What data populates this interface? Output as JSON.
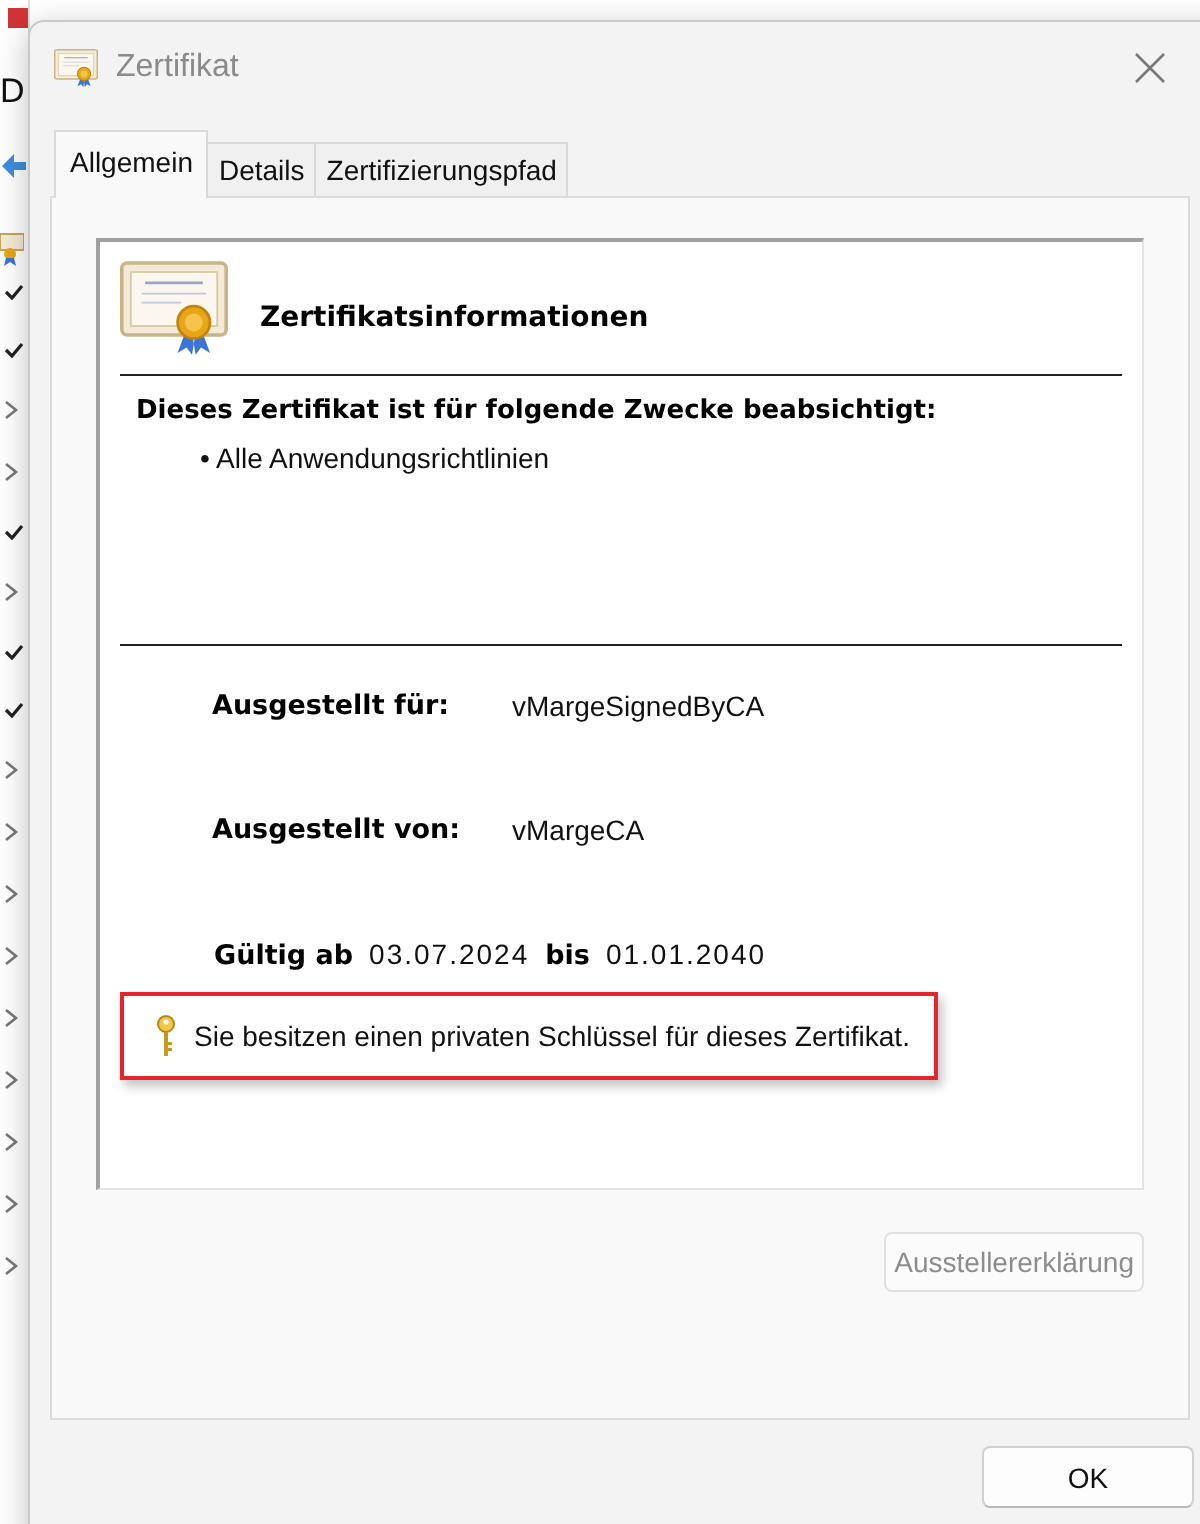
{
  "background_window": {
    "letter": "D",
    "marks": [
      {
        "kind": "check"
      },
      {
        "kind": "check"
      },
      {
        "kind": "chevron"
      },
      {
        "kind": "chevron"
      },
      {
        "kind": "check"
      },
      {
        "kind": "chevron"
      },
      {
        "kind": "check"
      },
      {
        "kind": "check"
      },
      {
        "kind": "chevron"
      },
      {
        "kind": "chevron"
      },
      {
        "kind": "chevron"
      },
      {
        "kind": "chevron"
      },
      {
        "kind": "chevron"
      },
      {
        "kind": "chevron"
      },
      {
        "kind": "chevron"
      },
      {
        "kind": "chevron"
      },
      {
        "kind": "chevron"
      }
    ]
  },
  "window": {
    "title": "Zertifikat"
  },
  "tabs": [
    {
      "label": "Allgemein",
      "selected": true
    },
    {
      "label": "Details",
      "selected": false
    },
    {
      "label": "Zertifizierungspfad",
      "selected": false
    }
  ],
  "info": {
    "heading": "Zertifikatsinformationen",
    "purpose_heading": "Dieses Zertifikat ist für folgende Zwecke beabsichtigt:",
    "purposes": [
      "• Alle Anwendungsrichtlinien"
    ],
    "fields": [
      {
        "label": "Ausgestellt für:",
        "value": "vMargeSignedByCA"
      },
      {
        "label": "Ausgestellt von:",
        "value": "vMargeCA"
      }
    ],
    "validity": {
      "from_label": "Gültig ab",
      "from": "03.07.2024",
      "to_label": "bis",
      "to": "01.01.2040"
    },
    "private_key_note": "Sie besitzen einen privaten Schlüssel für dieses Zertifikat.",
    "note_highlighted": true
  },
  "issuer_statement_button": {
    "label": "Ausstellererklärung",
    "disabled": true
  },
  "buttons": [
    {
      "label": "OK"
    }
  ]
}
